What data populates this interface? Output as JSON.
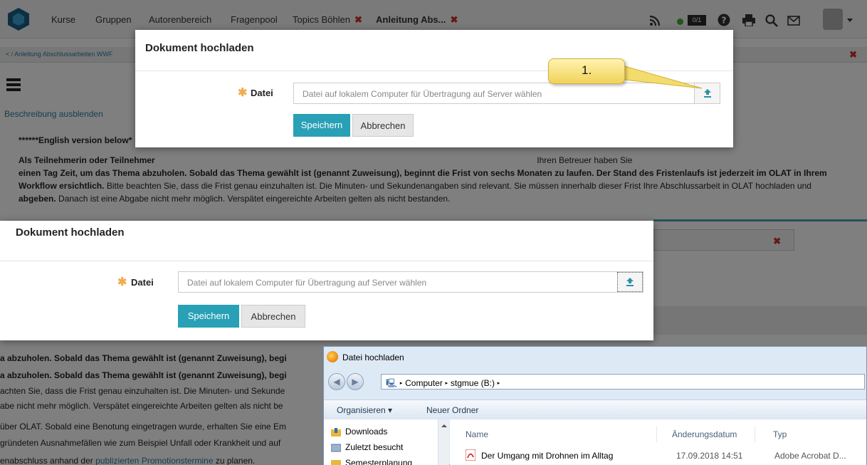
{
  "nav": {
    "links": [
      {
        "label": "Kurse"
      },
      {
        "label": "Gruppen"
      },
      {
        "label": "Autorenbereich"
      },
      {
        "label": "Fragenpool"
      },
      {
        "label": "Topics Böhlen"
      },
      {
        "label": "Anleitung Abs..."
      }
    ],
    "badge": "0/1",
    "close_mark": "✖"
  },
  "breadcrumb": {
    "back": "<",
    "text": "Anleitung Abschlussarbeiten WWF"
  },
  "description": {
    "toggle": "Beschreibung ausblenden",
    "english_note": "******English version below*",
    "p1_a": "Als Teilnehmerin oder Teilnehmer",
    "p1_b": "einen Tag Zeit, um das Thema abzuholen. Sobald das Thema gewählt ist (genannt Zuweisung), beginnt die Frist von sechs Monaten zu laufen. Der Stand des Fristenlaufs ist jederzeit im OLAT in Ihrem",
    "p1_c": "Workflow ersichtlich.",
    "p1_d": "Bitte beachten Sie, dass die Frist genau einzuhalten ist. Die Minuten- und Sekundenangaben sind relevant. Sie müssen innerhalb dieser Frist Ihre Abschlussarbeit in OLAT hochladen und",
    "p1_e": "abgeben.",
    "p1_f": "Danach ist eine Abgabe nicht mehr möglich. Verspätet eingereichte Arbeiten gelten als nicht bestanden.",
    "p1_right": "Ihren Betreuer haben Sie",
    "lower_lines": [
      "a abzuholen. Sobald das Thema gewählt ist (genannt Zuweisung), begi",
      "achten Sie, dass die Frist genau einzuhalten ist. Die Minuten- und Sekunde",
      "abe nicht mehr möglich. Verspätet eingereichte Arbeiten gelten als nicht be",
      "über OLAT. Sobald eine Benotung eingetragen wurde, erhalten Sie eine Em",
      "gründeten Ausnahmefällen wie zum Beispiel Unfall oder Krankheit und auf",
      "enabschluss anhand der"
    ],
    "link_text": "publizierten Promotionstermine",
    "after_link": "zu planen."
  },
  "modal_top": {
    "title": "Dokument hochladen",
    "required_mark": "✱",
    "label": "Datei",
    "placeholder": "Datei auf lokalem Computer für Übertragung auf Server wählen",
    "save": "Speichern",
    "cancel": "Abbrechen"
  },
  "callout": {
    "text": "1."
  },
  "modal_bottom": {
    "title": "Dokument hochladen",
    "required_mark": "✱",
    "label": "Datei",
    "placeholder": "Datei auf lokalem Computer für Übertragung auf Server wählen",
    "save": "Speichern",
    "cancel": "Abbrechen"
  },
  "file_dialog": {
    "title": "Datei hochladen",
    "path": [
      "Computer",
      "stgmue (B:)"
    ],
    "toolbar": {
      "organize": "Organisieren ▾",
      "new_folder": "Neuer Ordner"
    },
    "nav_items": [
      "Downloads",
      "Zuletzt besucht",
      "Semesterplanung"
    ],
    "columns": [
      "Name",
      "Änderungsdatum",
      "Typ"
    ],
    "files": [
      {
        "name": "Der Umgang mit Drohnen im Alltag",
        "date": "17.09.2018 14:51",
        "type": "Adobe Acrobat D..."
      }
    ]
  }
}
